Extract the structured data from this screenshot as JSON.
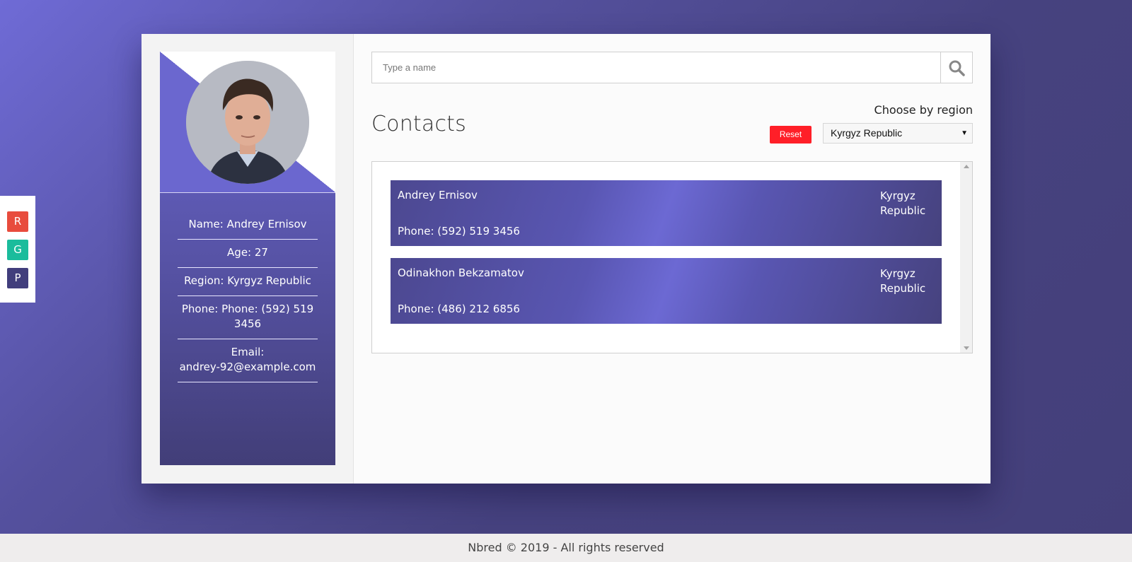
{
  "theme_switcher": {
    "buttons": [
      "R",
      "G",
      "P"
    ],
    "colors": [
      "#e84c3d",
      "#1abc9c",
      "#413e7c"
    ]
  },
  "profile": {
    "name": "Name: Andrey Ernisov",
    "age": "Age: 27",
    "region": "Region: Kyrgyz Republic",
    "phone": "Phone: Phone: (592) 519 3456",
    "email_label": "Email:",
    "email": "andrey-92@example.com"
  },
  "search": {
    "placeholder": "Type a name",
    "value": ""
  },
  "contacts": {
    "title": "Contacts",
    "choose_label": "Choose by region",
    "reset_label": "Reset",
    "selected_region": "Kyrgyz Republic",
    "items": [
      {
        "name": "Andrey Ernisov",
        "region": "Kyrgyz Republic",
        "phone": "Phone: (592) 519 3456"
      },
      {
        "name": "Odinakhon Bekzamatov",
        "region": "Kyrgyz Republic",
        "phone": "Phone: (486) 212 6856"
      }
    ]
  },
  "footer": {
    "text": "Nbred © 2019 - All rights reserved"
  },
  "colors": {
    "accent": "#6b67cf",
    "reset": "#ff1f28"
  }
}
